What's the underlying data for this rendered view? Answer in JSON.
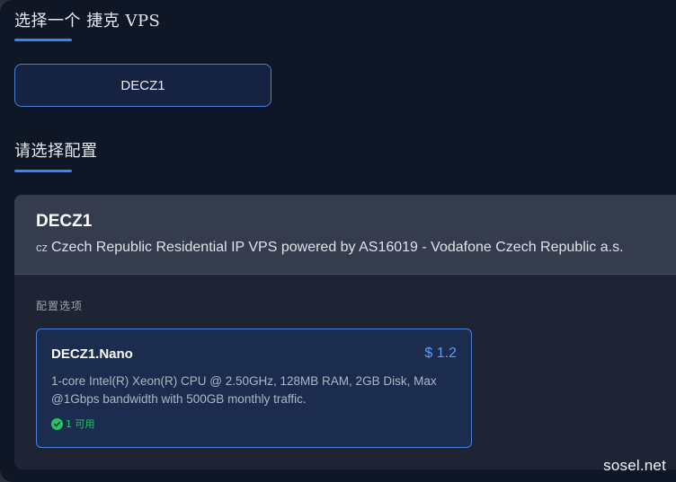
{
  "header": {
    "product_section_title": "选择一个 捷克 VPS",
    "config_section_title": "请选择配置"
  },
  "product_selector": {
    "selected_label": "DECZ1"
  },
  "product_panel": {
    "name": "DECZ1",
    "flag_code": "cz",
    "description": "Czech Republic Residential IP VPS powered by AS16019 - Vodafone Czech Republic a.s.",
    "options_label": "配置选项"
  },
  "plans": [
    {
      "name": "DECZ1.Nano",
      "price": "$ 1.2",
      "description": "1-core Intel(R) Xeon(R) CPU @ 2.50GHz, 128MB RAM, 2GB Disk, Max @1Gbps bandwidth with 500GB monthly traffic.",
      "availability": "1 可用",
      "availability_icon": "check-circle-icon"
    }
  ],
  "watermark": "sosel.net",
  "colors": {
    "accent": "#3b82f6",
    "price": "#5b9cf6",
    "available": "#22c55e",
    "background": "#0f1727"
  }
}
